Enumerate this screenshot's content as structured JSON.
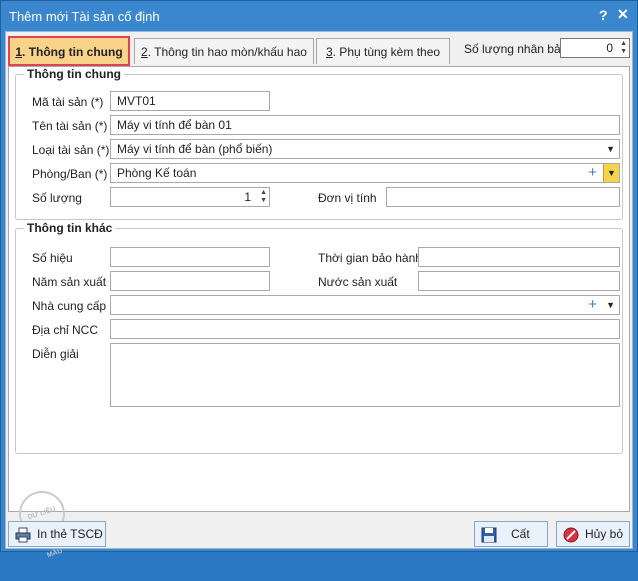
{
  "window": {
    "title": "Thêm mới Tài sản cố định",
    "help": "?",
    "close": "✕"
  },
  "tabs": [
    {
      "num": "1",
      "label": ". Thông tin chung"
    },
    {
      "num": "2",
      "label": ". Thông tin hao mòn/khấu hao"
    },
    {
      "num": "3",
      "label": ". Phụ tùng kèm theo"
    }
  ],
  "copies": {
    "label": "Số lượng nhân bản",
    "value": "0"
  },
  "general": {
    "title": "Thông tin chung",
    "code_label": "Mã tài sản (*)",
    "code_value": "MVT01",
    "name_label": "Tên tài sản (*)",
    "name_value": "Máy vi tính để bàn 01",
    "type_label": "Loại tài sản (*)",
    "type_value": "Máy vi tính để bàn (phổ biến)",
    "dept_label": "Phòng/Ban (*)",
    "dept_value": "Phòng Kế toán",
    "qty_label": "Số lượng",
    "qty_value": "1",
    "unit_label": "Đơn vị tính",
    "unit_value": ""
  },
  "other": {
    "title": "Thông tin khác",
    "serial_label": "Số hiệu",
    "serial_value": "",
    "warranty_label": "Thời gian bảo hành",
    "warranty_value": "",
    "year_label": "Năm sản xuất",
    "year_value": "",
    "country_label": "Nước sản xuất",
    "country_value": "",
    "supplier_label": "Nhà cung cấp",
    "supplier_value": "",
    "address_label": "Địa chỉ NCC",
    "address_value": "",
    "desc_label": "Diễn giải",
    "desc_value": ""
  },
  "stamp": "DỮ LIỆU MẪU",
  "buttons": {
    "print": "In thẻ TSCĐ",
    "save": "Cất",
    "cancel": "Hủy bỏ"
  },
  "colors": {
    "title_bar": "#3b87cf",
    "active_tab": "#f9d38a",
    "active_tab_border": "#e0434e"
  }
}
